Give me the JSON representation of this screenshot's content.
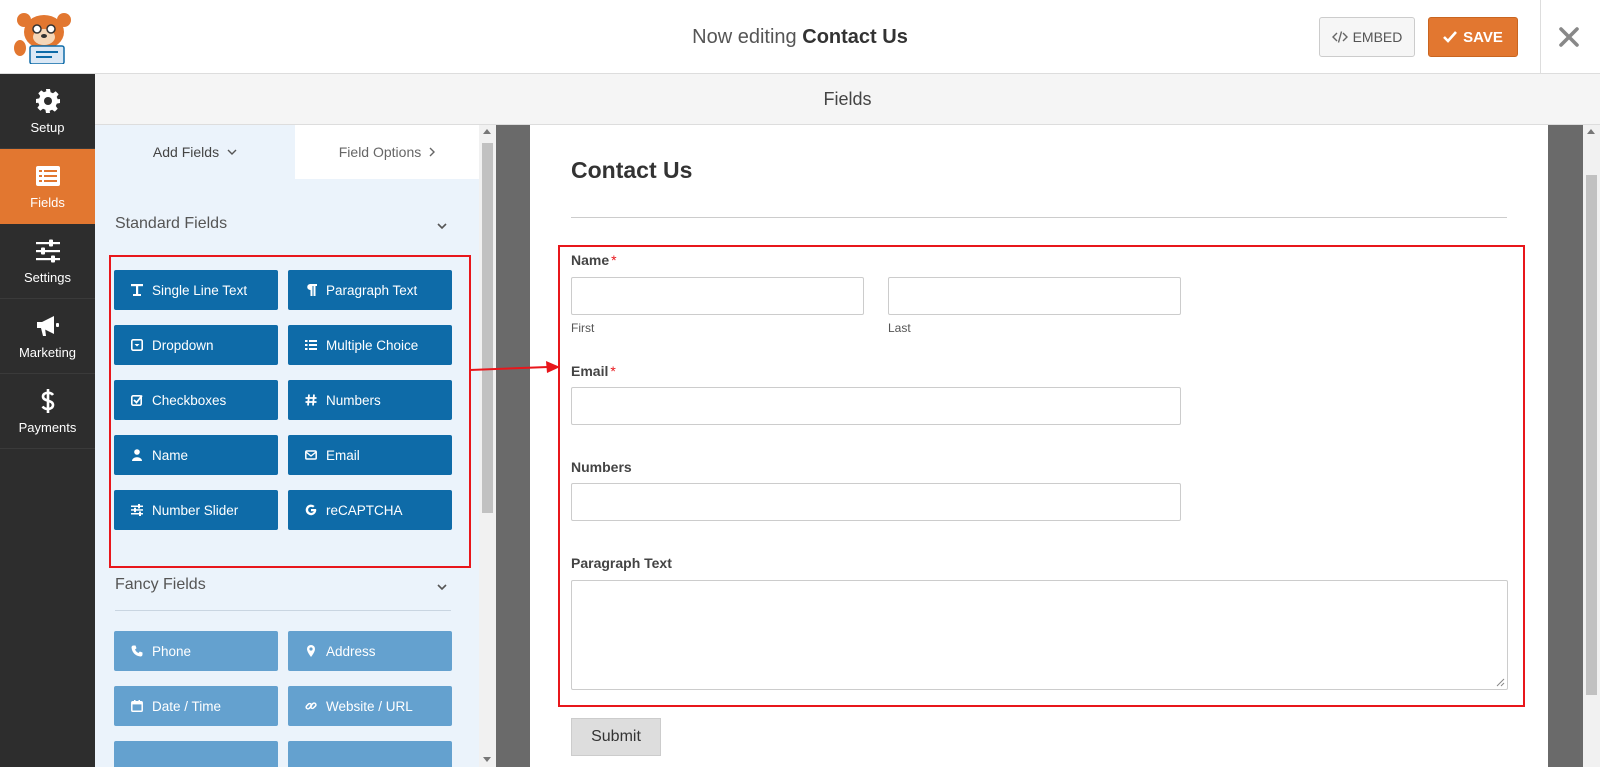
{
  "header": {
    "title_prefix": "Now editing",
    "title_form": "Contact Us",
    "embed_label": "EMBED",
    "save_label": "SAVE"
  },
  "nav": [
    {
      "label": "Setup",
      "icon": "gear-icon"
    },
    {
      "label": "Fields",
      "icon": "fields-list-icon",
      "active": true
    },
    {
      "label": "Settings",
      "icon": "sliders-icon"
    },
    {
      "label": "Marketing",
      "icon": "megaphone-icon"
    },
    {
      "label": "Payments",
      "icon": "dollar-icon"
    }
  ],
  "section_header": "Fields",
  "panel": {
    "tab_add": "Add Fields",
    "tab_options": "Field Options",
    "standard_title": "Standard Fields",
    "standard_fields": [
      {
        "label": "Single Line Text",
        "icon": "text-icon"
      },
      {
        "label": "Paragraph Text",
        "icon": "paragraph-icon"
      },
      {
        "label": "Dropdown",
        "icon": "dropdown-icon"
      },
      {
        "label": "Multiple Choice",
        "icon": "list-icon"
      },
      {
        "label": "Checkboxes",
        "icon": "checkbox-icon"
      },
      {
        "label": "Numbers",
        "icon": "hash-icon"
      },
      {
        "label": "Name",
        "icon": "user-icon"
      },
      {
        "label": "Email",
        "icon": "envelope-icon"
      },
      {
        "label": "Number Slider",
        "icon": "slider-icon"
      },
      {
        "label": "reCAPTCHA",
        "icon": "google-icon"
      }
    ],
    "fancy_title": "Fancy Fields",
    "fancy_fields": [
      {
        "label": "Phone",
        "icon": "phone-icon"
      },
      {
        "label": "Address",
        "icon": "map-marker-icon"
      },
      {
        "label": "Date / Time",
        "icon": "calendar-icon"
      },
      {
        "label": "Website / URL",
        "icon": "link-icon"
      }
    ]
  },
  "form": {
    "title": "Contact Us",
    "name_label": "Name",
    "name_first_sublabel": "First",
    "name_last_sublabel": "Last",
    "email_label": "Email",
    "numbers_label": "Numbers",
    "paragraph_label": "Paragraph Text",
    "required_mark": "*",
    "submit_label": "Submit"
  },
  "colors": {
    "accent": "#e27730",
    "field_button": "#0e6ba8",
    "fancy_button": "#64a1cf",
    "annotation_red": "#e8161b"
  }
}
